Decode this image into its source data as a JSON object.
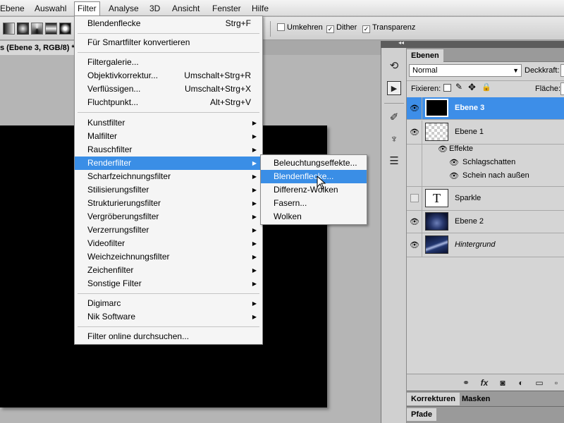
{
  "menubar": {
    "items": [
      "Ebene",
      "Auswahl",
      "Filter",
      "Analyse",
      "3D",
      "Ansicht",
      "Fenster",
      "Hilfe"
    ],
    "active": "Filter"
  },
  "options": {
    "umkehren": "Umkehren",
    "dither": "Dither",
    "transparenz": "Transparenz"
  },
  "document": {
    "tab_title": "s (Ebene 3, RGB/8) *"
  },
  "filter_menu": {
    "last_filter": "Blendenflecke",
    "last_filter_shortcut": "Strg+F",
    "smart": "Für Smartfilter konvertieren",
    "galerie": "Filtergalerie...",
    "objektiv": "Objektivkorrektur...",
    "objektiv_sc": "Umschalt+Strg+R",
    "verfluessigen": "Verflüssigen...",
    "verfluessigen_sc": "Umschalt+Strg+X",
    "flucht": "Fluchtpunkt...",
    "flucht_sc": "Alt+Strg+V",
    "groups": [
      "Kunstfilter",
      "Malfilter",
      "Rauschfilter",
      "Renderfilter",
      "Scharfzeichnungsfilter",
      "Stilisierungsfilter",
      "Strukturierungsfilter",
      "Vergröberungsfilter",
      "Verzerrungsfilter",
      "Videofilter",
      "Weichzeichnungsfilter",
      "Zeichenfilter",
      "Sonstige Filter"
    ],
    "plugins": [
      "Digimarc",
      "Nik Software"
    ],
    "online": "Filter online durchsuchen..."
  },
  "render_submenu": {
    "items": [
      "Beleuchtungseffekte...",
      "Blendenflecke...",
      "Differenz-Wolken",
      "Fasern...",
      "Wolken"
    ],
    "highlighted": "Blendenflecke..."
  },
  "layers_panel": {
    "tab": "Ebenen",
    "blend_mode": "Normal",
    "opacity_label": "Deckkraft:",
    "lock_label": "Fixieren:",
    "fill_label": "Fläche:",
    "layers": {
      "ebene3": "Ebene 3",
      "ebene1": "Ebene 1",
      "effekte": "Effekte",
      "schlagschatten": "Schlagschatten",
      "schein": "Schein nach außen",
      "sparkle": "Sparkle",
      "sparkle_thumb": "T",
      "ebene2": "Ebene 2",
      "hintergrund": "Hintergrund"
    }
  },
  "bottom_panels": {
    "korrekturen": "Korrekturen",
    "masken": "Masken",
    "pfade": "Pfade"
  },
  "colors": {
    "menu_highlight": "#3a8ee6",
    "layer_selected": "#3d8ee8"
  }
}
